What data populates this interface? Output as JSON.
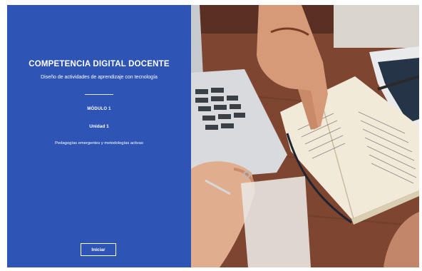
{
  "panel": {
    "title": "COMPETENCIA DIGITAL DOCENTE",
    "subtitle": "Diseño de actividades de aprendizaje con tecnología",
    "module": "MÓDULO 1",
    "unit": "Unidad 1",
    "topic": "Pedagogías emergentes y metodologías activas",
    "start_button": "Iniciar"
  },
  "colors": {
    "panel_background": "#2e55b5",
    "table_wood": "#8a4a30"
  }
}
